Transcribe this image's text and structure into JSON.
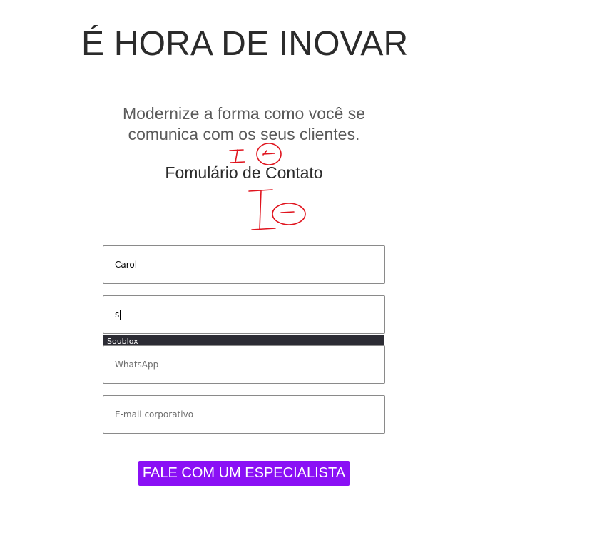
{
  "hero": {
    "title": "É HORA DE INOVAR",
    "subtitle_line1": "Modernize a forma como você se",
    "subtitle_line2": "comunica com os seus clientes."
  },
  "form": {
    "title": "Fomulário de Contato",
    "fields": {
      "name": {
        "value": "Carol",
        "placeholder": ""
      },
      "company": {
        "value": "s",
        "placeholder": ""
      },
      "whatsapp": {
        "value": "",
        "placeholder": "WhatsApp"
      },
      "email": {
        "value": "",
        "placeholder": "E-mail corporativo"
      }
    },
    "autocomplete_suggestion": "Soublox",
    "submit_label": "FALE COM UM ESPECIALISTA"
  },
  "colors": {
    "button_background": "#8a10f5",
    "button_text": "#ffffff",
    "autocomplete_background": "#2c2c34",
    "annotation_ink": "#e0141e"
  }
}
